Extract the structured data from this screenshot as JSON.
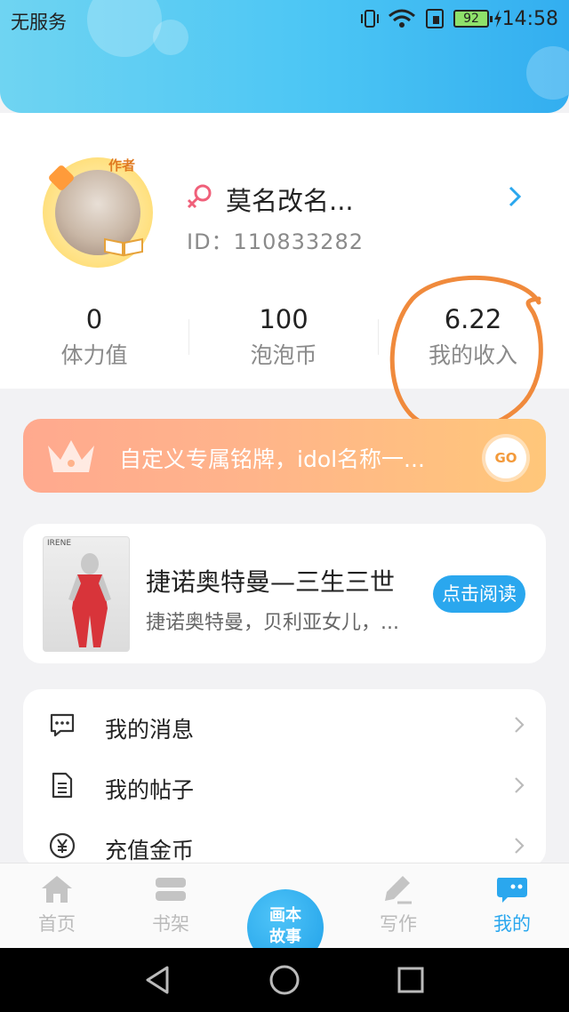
{
  "status_bar": {
    "carrier": "无服务",
    "battery": "92",
    "time": "14:58"
  },
  "profile": {
    "author_tag": "作者",
    "username": "莫名改名...",
    "uid": "ID：110833282",
    "stats": [
      {
        "value": "0",
        "label": "体力值"
      },
      {
        "value": "100",
        "label": "泡泡币"
      },
      {
        "value": "6.22",
        "label": "我的收入"
      }
    ]
  },
  "promo": {
    "text": "自定义专属铭牌，idol名称一...",
    "go_label": "GO"
  },
  "book": {
    "cover_label": "IRENE",
    "title": "捷诺奥特曼—三生三世",
    "desc": "捷诺奥特曼，贝利亚女儿，...",
    "read_button": "点击阅读"
  },
  "menu": {
    "items": [
      {
        "label": "我的消息",
        "icon": "message-icon"
      },
      {
        "label": "我的帖子",
        "icon": "document-icon"
      },
      {
        "label": "充值金币",
        "icon": "yuan-coin-icon"
      }
    ]
  },
  "bottom_nav": {
    "items": [
      {
        "label": "首页",
        "icon": "home-icon"
      },
      {
        "label": "书架",
        "icon": "bookshelf-icon"
      },
      {
        "label": "写作",
        "icon": "pen-icon"
      },
      {
        "label": "我的",
        "icon": "chat-face-icon"
      }
    ],
    "center_line1": "画本",
    "center_line2": "故事",
    "active": "我的"
  },
  "colors": {
    "accent": "#2aa7ee",
    "header_gradient_end": "#33aef0",
    "promo_start": "#ffa98e",
    "promo_end": "#ffc77a",
    "annotation": "#f08a3c"
  }
}
